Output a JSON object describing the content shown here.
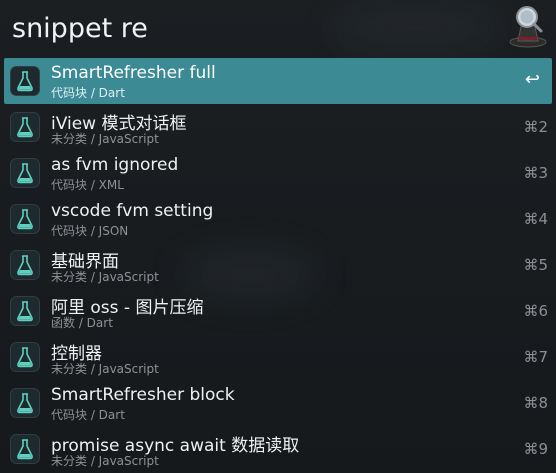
{
  "search": {
    "query": "snippet re"
  },
  "app": {
    "icon": "alfred-hat-icon"
  },
  "results": [
    {
      "title": "SmartRefresher full",
      "subtitle": "代码块 / Dart",
      "shortcut": "↩",
      "selected": true
    },
    {
      "title": "iView 模式对话框",
      "subtitle": "未分类 / JavaScript",
      "shortcut": "⌘2"
    },
    {
      "title": "as fvm ignored",
      "subtitle": "代码块 / XML",
      "shortcut": "⌘3"
    },
    {
      "title": "vscode fvm setting",
      "subtitle": "代码块 / JSON",
      "shortcut": "⌘4"
    },
    {
      "title": "基础界面",
      "subtitle": "未分类 / JavaScript",
      "shortcut": "⌘5"
    },
    {
      "title": "阿里 oss - 图片压缩",
      "subtitle": "函数 / Dart",
      "shortcut": "⌘6"
    },
    {
      "title": "控制器",
      "subtitle": "未分类 / JavaScript",
      "shortcut": "⌘7"
    },
    {
      "title": "SmartRefresher block",
      "subtitle": "代码块 / Dart",
      "shortcut": "⌘8"
    },
    {
      "title": "promise  async await 数据读取",
      "subtitle": "未分类 / JavaScript",
      "shortcut": "⌘9"
    }
  ],
  "colors": {
    "selected": "#3c8a94",
    "background": "#161a1d",
    "flask": "#5fd0c0"
  }
}
